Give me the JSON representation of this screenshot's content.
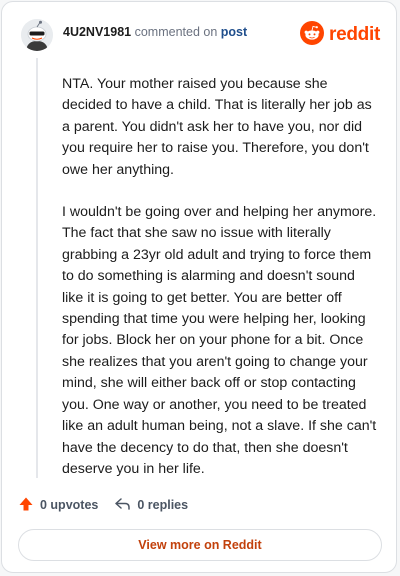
{
  "header": {
    "username": "4U2NV1981",
    "commented_on": "commented on",
    "post_link": "post",
    "brand": "reddit"
  },
  "comment": {
    "paragraphs": [
      "NTA. Your mother raised you because she decided to have a child. That is literally her job as a parent. You didn't ask her to have you, nor did you require her to raise you. Therefore, you don't owe her anything.",
      "I wouldn't be going over and helping her anymore. The fact that she saw no issue with literally grabbing a 23yr old adult and trying to force them to do something is alarming and doesn't sound like it is going to get better. You are better off spending that time you were helping her, looking for jobs. Block her on your phone for a bit. Once she realizes that you aren't going to change your mind, she will either back off or stop contacting you. One way or another, you need to be treated like an adult human being, not a slave. If she can't have the decency to do that, then she doesn't deserve you in her life."
    ]
  },
  "actions": {
    "upvotes": "0 upvotes",
    "replies": "0 replies"
  },
  "footer": {
    "view_more": "View more on Reddit"
  },
  "icons": {
    "avatar": "snoo-avatar-icon",
    "brand": "reddit-logo-icon",
    "upvote": "upvote-arrow-icon",
    "reply": "reply-arrow-icon"
  },
  "colors": {
    "brand": "#ff4500",
    "upvote": "#ff4500",
    "link": "#1f4e8c",
    "view_more": "#c2410c"
  }
}
